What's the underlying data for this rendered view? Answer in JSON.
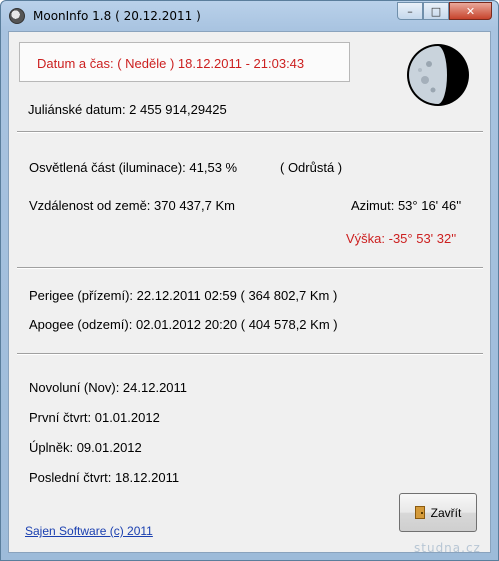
{
  "window": {
    "title": "MoonInfo 1.8 ( 20.12.2011 )"
  },
  "caption_buttons": {
    "minimize": "–",
    "maximize": "□",
    "close": "✕"
  },
  "datetime": "Datum a čas: ( Neděle ) 18.12.2011 - 21:03:43",
  "julian": "Juliánské datum: 2 455 914,29425",
  "illumination": {
    "text": "Osvětlená část (iluminace): 41,53 %",
    "phase": "( Odrůstá )"
  },
  "distance": "Vzdálenost od země: 370 437,7 Km",
  "azimuth": "Azimut: 53° 16' 46''",
  "altitude": "Výška:  -35° 53' 32''",
  "perigee": "Perigee (přízemí):  22.12.2011 02:59  ( 364 802,7 Km )",
  "apogee": "Apogee (odzemí):  02.01.2012 20:20  ( 404 578,2 Km )",
  "phases": {
    "new_moon": "Novoluní (Nov):  24.12.2011",
    "first_quarter": "První čtvrt:  01.01.2012",
    "full_moon": "Úplněk:  09.01.2012",
    "last_quarter": "Poslední čtvrt:  18.12.2011"
  },
  "footer": {
    "link": "Sajen Software (c) 2011",
    "close_button": "Zavřít"
  },
  "watermark": "studna.cz",
  "colors": {
    "accent_red": "#cc1f1f",
    "link_blue": "#1a3fb0"
  },
  "moon": {
    "illumination_percent": 41.53
  }
}
